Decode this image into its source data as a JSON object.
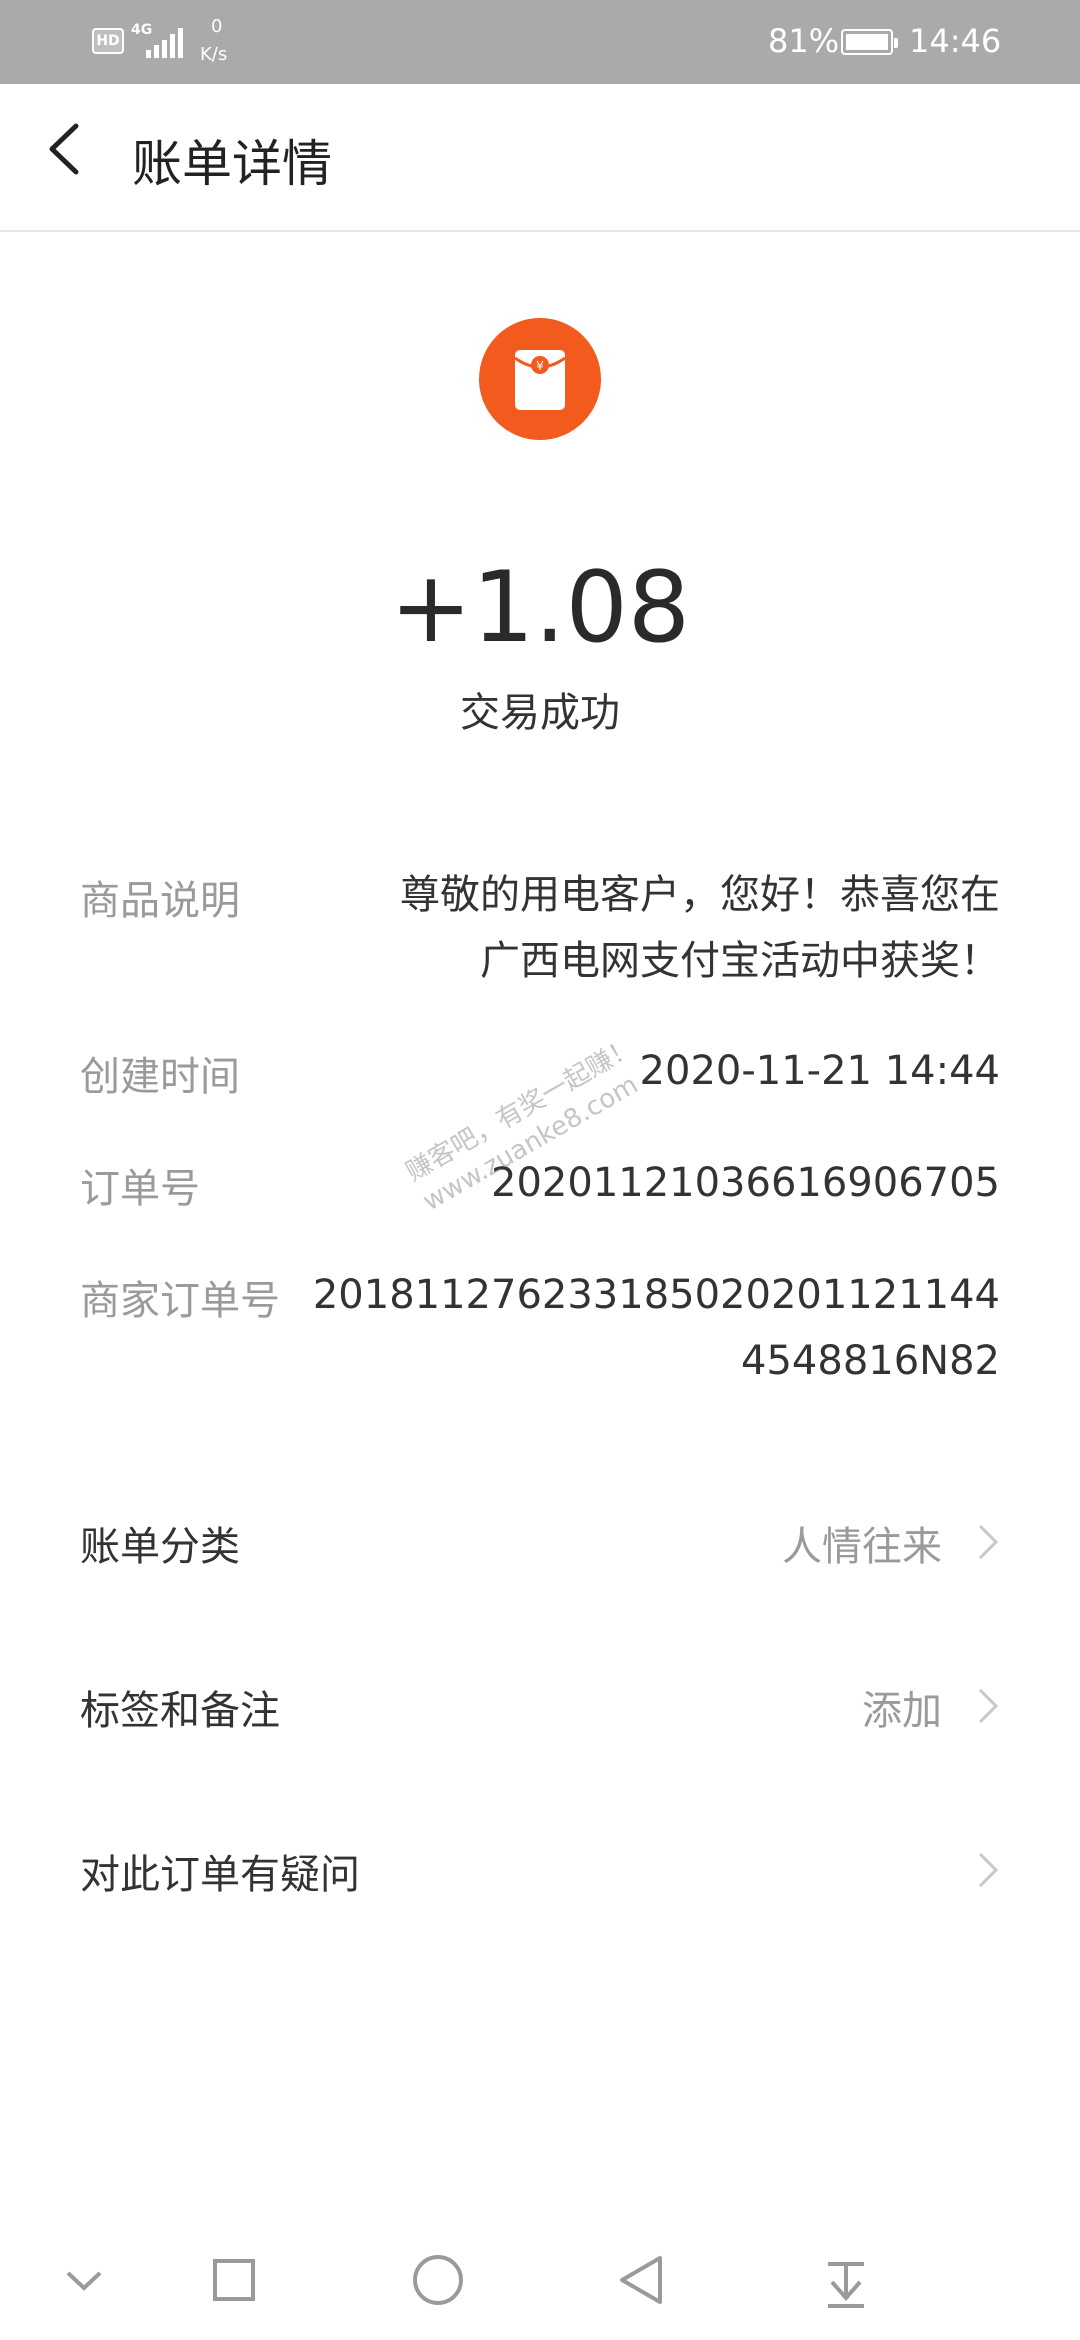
{
  "status_bar": {
    "hd": "HD",
    "network": "4G",
    "speed_value": "0",
    "speed_unit": "K/s",
    "battery_percent": "81%",
    "time": "14:46"
  },
  "header": {
    "title": "账单详情",
    "back_icon": "chevron-left-icon"
  },
  "summary": {
    "icon": "red-envelope-icon",
    "icon_color": "#F25A1E",
    "amount": "+1.08",
    "status": "交易成功"
  },
  "details": {
    "product_label": "商品说明",
    "product_value_line1": "尊敬的用电客户，您好！恭喜您在",
    "product_value_line2": "广西电网支付宝活动中获奖！",
    "created_label": "创建时间",
    "created_value": "2020-11-21 14:44",
    "order_label": "订单号",
    "order_value": "20201121036616906705",
    "merchant_order_label": "商家订单号",
    "merchant_order_line1": "2018112762331850202011211​44",
    "merchant_order_line2": "4548816N82"
  },
  "actions": {
    "category_label": "账单分类",
    "category_value": "人情往来",
    "tags_label": "标签和备注",
    "tags_value": "添加",
    "question_label": "对此订单有疑问"
  },
  "watermark": {
    "line1": "赚客吧，有奖一起赚！",
    "line2": "www.zuanke8.com"
  },
  "nav_bar": {
    "buttons": [
      "collapse-icon",
      "recents-icon",
      "home-icon",
      "back-icon",
      "notification-pull-icon"
    ]
  }
}
